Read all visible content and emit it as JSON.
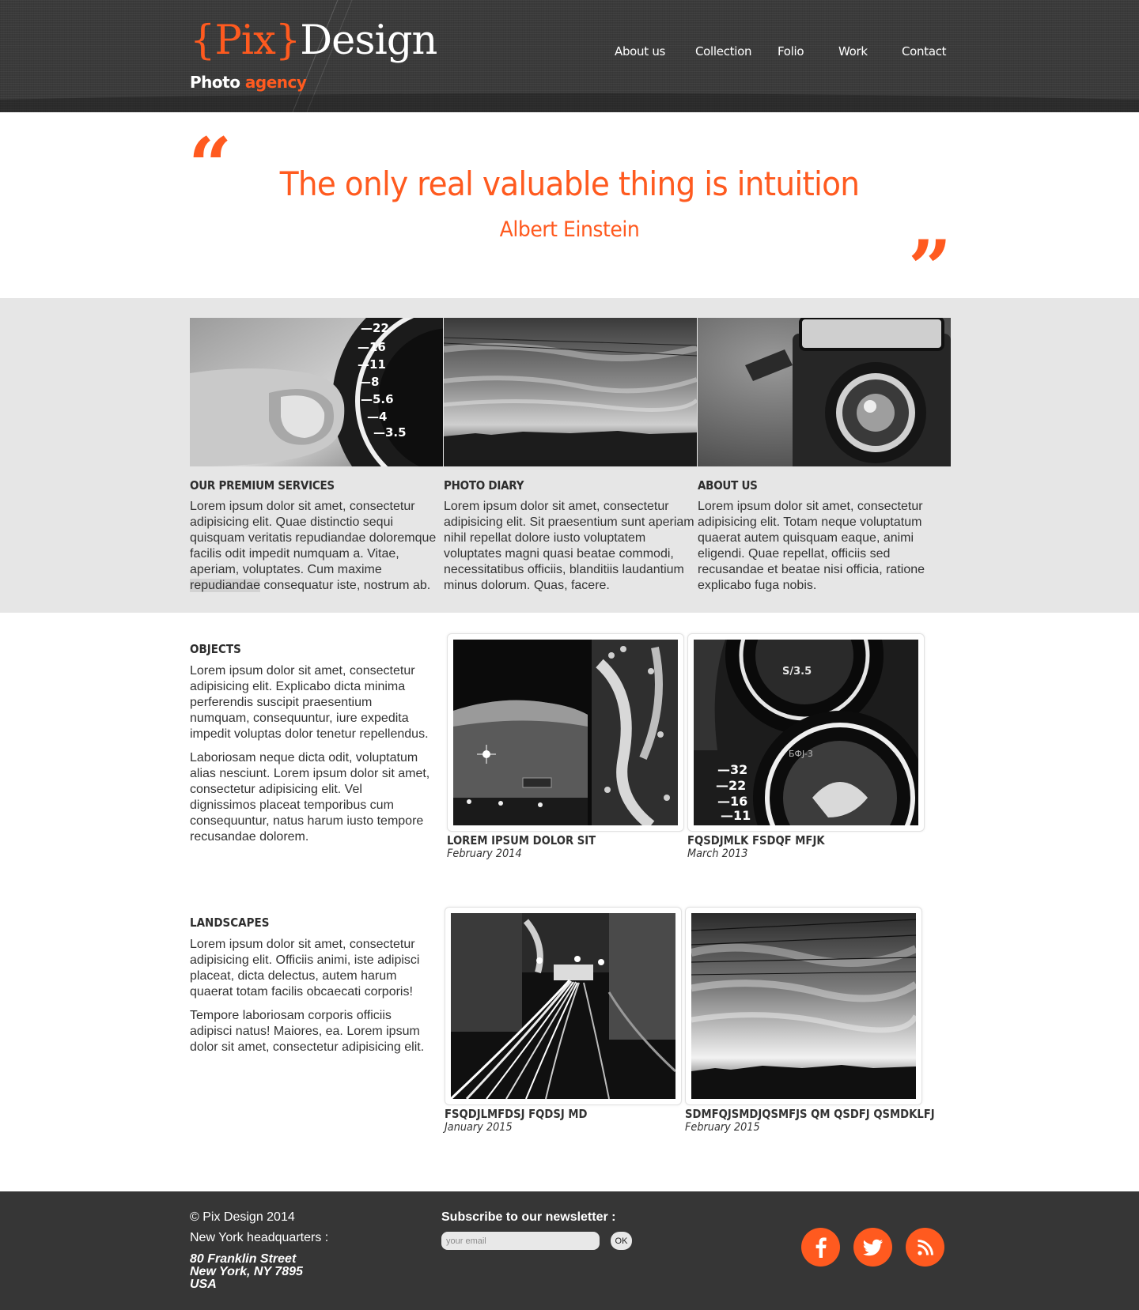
{
  "header": {
    "logo": {
      "brace_open": "{",
      "pix": "Pix",
      "brace_close": "}",
      "design": "Design"
    },
    "tagline": {
      "white": "Photo",
      "orange": "agency"
    },
    "nav": [
      {
        "label": "About us"
      },
      {
        "label": "Collection"
      },
      {
        "label": "Folio"
      },
      {
        "label": "Work"
      },
      {
        "label": "Contact"
      }
    ]
  },
  "quote": {
    "open_mark": "“",
    "close_mark": "”",
    "text": "The only real valuable thing is intuition",
    "author": "Albert Einstein"
  },
  "services": [
    {
      "title": "OUR PREMIUM SERVICES",
      "text_before": "Lorem ipsum dolor sit amet, consectetur adipisicing elit. Quae distinctio sequi quisquam veritatis repudiandae doloremque facilis odit impedit numquam a. Vitae, aperiam, voluptates. Cum maxime ",
      "highlight": "repudiandae",
      "text_after": " consequatur iste, nostrum ab."
    },
    {
      "title": "PHOTO DIARY",
      "text": "Lorem ipsum dolor sit amet, consectetur adipisicing elit. Sit praesentium sunt aperiam nihil repellat dolore iusto voluptatem voluptates magni quasi beatae commodi, necessitatibus officiis, blanditiis laudantium minus dolorum. Quas, facere."
    },
    {
      "title": "ABOUT US",
      "text": "Lorem ipsum dolor sit amet, consectetur adipisicing elit. Totam neque voluptatum quaerat autem quisquam eaque, animi eligendi. Quae repellat, officiis sed recusandae et beatae nisi officia, ratione explicabo fuga nobis."
    }
  ],
  "galleries": [
    {
      "title": "OBJECTS",
      "paragraphs": [
        "Lorem ipsum dolor sit amet, consectetur adipisicing elit. Explicabo dicta minima perferendis suscipit praesentium numquam, consequuntur, iure expedita impedit voluptas dolor tenetur repellendus.",
        "Laboriosam neque dicta odit, voluptatum alias nesciunt. Lorem ipsum dolor sit amet, consectetur adipisicing elit. Vel dignissimos placeat temporibus cum consequuntur, natus harum iusto tempore recusandae dolorem."
      ],
      "cards": [
        {
          "title": "LOREM IPSUM DOLOR SIT",
          "date": "February 2014"
        },
        {
          "title": "FQSDJMLK FSDQF MFJK",
          "date": "March 2013"
        }
      ]
    },
    {
      "title": "LANDSCAPES",
      "paragraphs": [
        "Lorem ipsum dolor sit amet, consectetur adipisicing elit. Officiis animi, iste adipisci placeat, dicta delectus, autem harum quaerat totam facilis obcaecati corporis!",
        "Tempore laboriosam corporis officiis adipisci natus! Maiores, ea. Lorem ipsum dolor sit amet, consectetur adipisicing elit."
      ],
      "cards": [
        {
          "title": "FSQDJLMFDSJ FQDSJ MD",
          "date": "January 2015"
        },
        {
          "title": "SDMFQJSMDJQSMFJS QM QSDFJ QSMDKLFJ",
          "date": "February 2015"
        }
      ]
    }
  ],
  "footer": {
    "copyright": "© Pix Design 2014",
    "hq_label": "New York headquarters :",
    "address": [
      "80 Franklin Street",
      "New York, NY 7895",
      "USA"
    ],
    "newsletter_label": "Subscribe to our newsletter :",
    "email_placeholder": "your email",
    "ok_label": "OK",
    "social": [
      {
        "icon": "facebook-icon"
      },
      {
        "icon": "twitter-icon"
      },
      {
        "icon": "rss-icon"
      }
    ]
  },
  "colors": {
    "accent": "#ff5a1f",
    "header_bg": "#3a3a3a",
    "band_bg": "#e6e6e6",
    "footer_bg": "#363636",
    "text": "#333333"
  }
}
